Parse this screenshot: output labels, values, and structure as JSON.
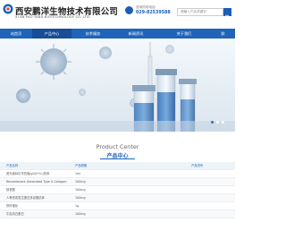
{
  "header": {
    "brand_cn": "西安鹏洋生物技术有限公司",
    "brand_en": "XI AN PAO YANG BIOTECHNOLOGY CO.,LTD.",
    "phone_label": "咨询热线电话",
    "phone": "029-82539588",
    "search_placeholder": "请输入产品关键字"
  },
  "nav": {
    "items": [
      {
        "label": "站首页"
      },
      {
        "label": "产品中心"
      },
      {
        "label": "技术服务"
      },
      {
        "label": "新闻资讯"
      },
      {
        "label": "关于我们"
      },
      {
        "label": "联"
      }
    ],
    "active_index": 1,
    "color": "#1f64b8"
  },
  "banner": {
    "slide_count": 3,
    "active_slide": 0
  },
  "section": {
    "title_en": "Product Center",
    "title_cn": "产品中心"
  },
  "table": {
    "headers": [
      "产品名称",
      "产品规格",
      "产品货号"
    ],
    "rows": [
      [
        "荧光素标记羊抗兔IgG(H+L)抗体",
        "1ml",
        ""
      ],
      [
        "Recombinant Generated Type X Collagen",
        "100mg",
        ""
      ],
      [
        "核苷酸",
        "100mg",
        ""
      ],
      [
        "人骨形态发生蛋白多克隆抗体",
        "100mg",
        ""
      ],
      [
        "肝纤维化",
        "1g",
        ""
      ],
      [
        "牛血清白蛋白",
        "100mg",
        ""
      ]
    ]
  }
}
